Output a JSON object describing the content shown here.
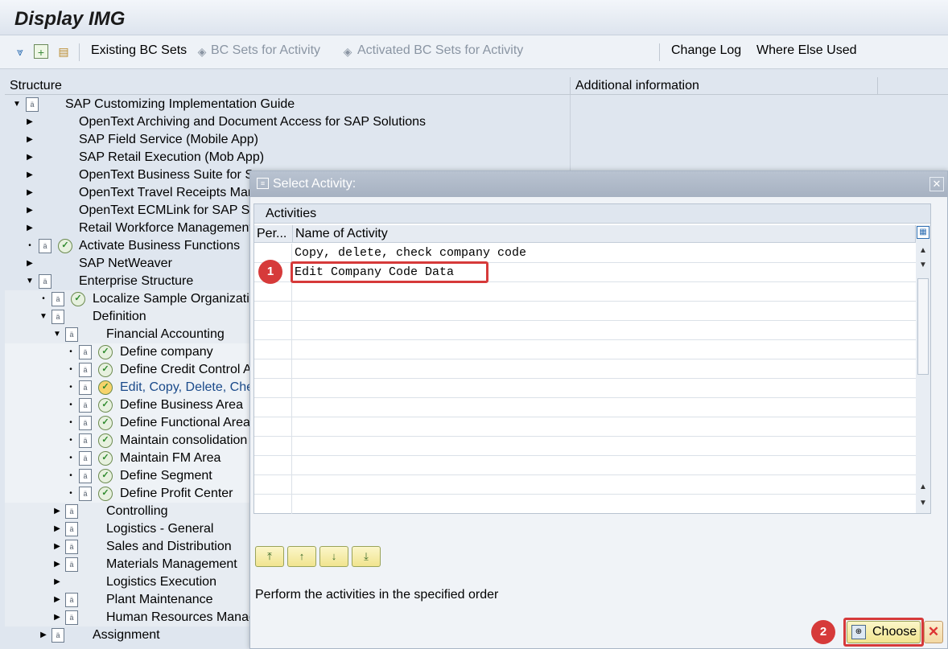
{
  "window": {
    "title": "Display IMG"
  },
  "toolbar": {
    "existing_bc_sets": "Existing BC Sets",
    "bc_sets_for_activity": "BC Sets for Activity",
    "activated_bc_sets": "Activated BC Sets for Activity",
    "change_log": "Change Log",
    "where_else_used": "Where Else Used"
  },
  "panes": {
    "structure": "Structure",
    "additional_info": "Additional information"
  },
  "tree": [
    {
      "label": "SAP Customizing Implementation Guide"
    },
    {
      "label": "OpenText Archiving and Document Access for SAP Solutions"
    },
    {
      "label": "SAP Field Service (Mobile App)"
    },
    {
      "label": "SAP Retail Execution (Mob App)"
    },
    {
      "label": "OpenText Business Suite for S"
    },
    {
      "label": "OpenText Travel Receipts Man"
    },
    {
      "label": "OpenText ECMLink for SAP Sc"
    },
    {
      "label": "Retail Workforce Management"
    },
    {
      "label": "Activate Business Functions"
    },
    {
      "label": "SAP NetWeaver"
    },
    {
      "label": "Enterprise Structure"
    },
    {
      "label": "Localize Sample Organizatio"
    },
    {
      "label": "Definition"
    },
    {
      "label": "Financial Accounting"
    },
    {
      "label": "Define company"
    },
    {
      "label": "Define Credit Control A"
    },
    {
      "label": "Edit, Copy, Delete, Che"
    },
    {
      "label": "Define Business Area"
    },
    {
      "label": "Define Functional Area"
    },
    {
      "label": "Maintain consolidation"
    },
    {
      "label": "Maintain FM Area"
    },
    {
      "label": "Define Segment"
    },
    {
      "label": "Define Profit Center"
    },
    {
      "label": "Controlling"
    },
    {
      "label": "Logistics - General"
    },
    {
      "label": "Sales and Distribution"
    },
    {
      "label": "Materials Management"
    },
    {
      "label": "Logistics Execution"
    },
    {
      "label": "Plant Maintenance"
    },
    {
      "label": "Human Resources Manag"
    },
    {
      "label": "Assignment"
    }
  ],
  "dialog": {
    "title": "Select Activity:",
    "table_caption": "Activities",
    "col_per": "Per...",
    "col_name": "Name of Activity",
    "rows": [
      "Copy, delete, check company code",
      "Edit Company Code Data"
    ],
    "instruction": "Perform the activities in the specified order",
    "choose": "Choose"
  },
  "markers": {
    "m1": "1",
    "m2": "2"
  },
  "colors": {
    "title_bar": "#a6b1c1",
    "marker": "#d63a3a",
    "button": "#f1e48f"
  }
}
